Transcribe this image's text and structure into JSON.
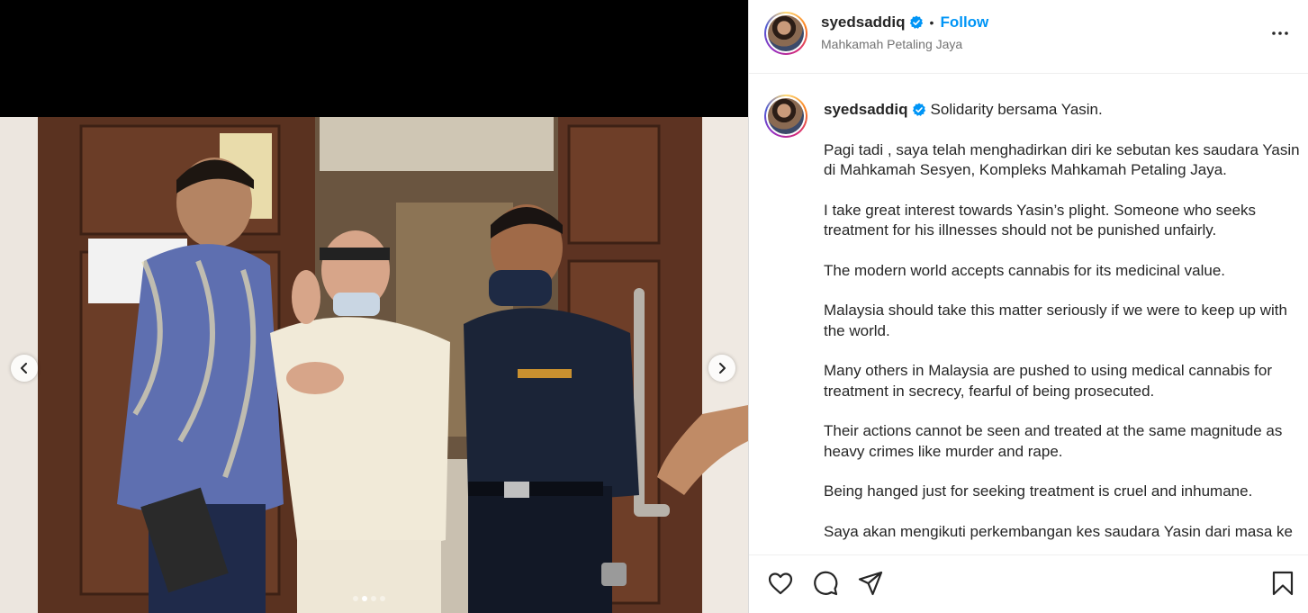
{
  "post": {
    "username": "syedsaddiq",
    "follow_label": "Follow",
    "separator": "•",
    "location": "Mahkamah Petaling Jaya"
  },
  "caption": {
    "username": "syedsaddiq",
    "title": "Solidarity bersama Yasin.",
    "paragraphs": [
      "Pagi tadi , saya telah menghadirkan diri ke sebutan kes saudara Yasin di Mahkamah Sesyen, Kompleks Mahkamah Petaling Jaya.",
      "I take great interest towards Yasin’s plight. Someone who seeks treatment for his illnesses should not be punished unfairly.",
      "The modern world accepts cannabis for its medicinal value.",
      "Malaysia should take this matter seriously if we were to keep up with the world.",
      "Many others in Malaysia are pushed to using medical cannabis for treatment in secrecy, fearful of being prosecuted.",
      "Their actions cannot be seen and treated at the same magnitude as heavy crimes like murder and rape.",
      "Being hanged just for seeking treatment is cruel and inhumane.",
      "Saya akan mengikuti perkembangan kes saudara Yasin dari masa ke"
    ]
  },
  "carousel": {
    "total": 4,
    "active_index": 1
  },
  "icons": {
    "verified": "verified-badge-icon",
    "more": "more-options-icon",
    "like": "heart-icon",
    "comment": "comment-icon",
    "share": "share-icon",
    "save": "bookmark-icon",
    "prev": "chevron-left-icon",
    "next": "chevron-right-icon"
  },
  "colors": {
    "accent": "#0095f6",
    "text": "#262626",
    "muted": "#737373"
  }
}
